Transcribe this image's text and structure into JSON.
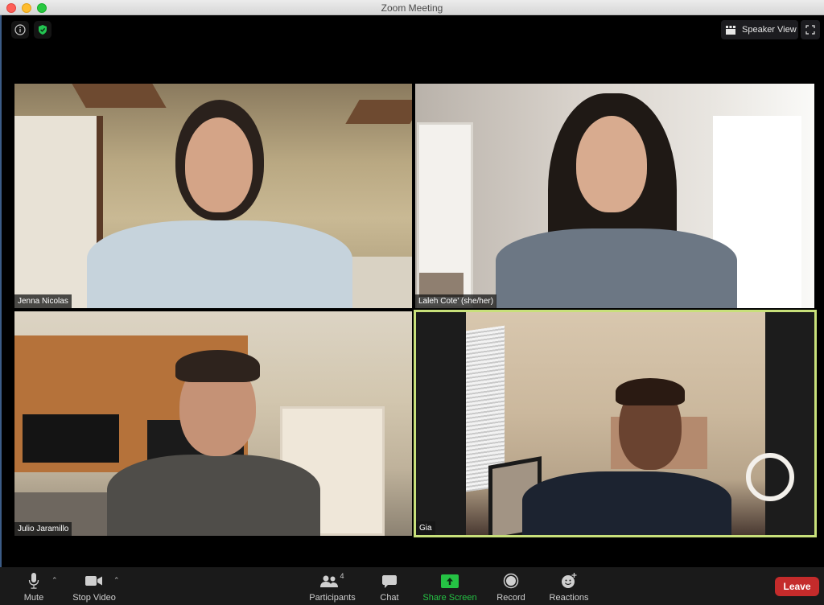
{
  "window": {
    "title": "Zoom Meeting"
  },
  "top_bar": {
    "info_icon": "info-icon",
    "security_icon": "shield-check-icon",
    "security_color": "#23c552",
    "view_button_label": "Speaker View",
    "view_button_icon": "grid-icon",
    "fullscreen_icon": "fullscreen-icon"
  },
  "participants": [
    {
      "name": "Jenna Nicolas",
      "active_speaker": false
    },
    {
      "name": "Laleh Cote' (she/her)",
      "active_speaker": false
    },
    {
      "name": "Julio Jaramillo",
      "active_speaker": false
    },
    {
      "name": "Gia",
      "active_speaker": true
    }
  ],
  "active_speaker_border_color": "#c8e07a",
  "toolbar": {
    "mute": {
      "label": "Mute",
      "icon": "microphone-icon"
    },
    "stop_video": {
      "label": "Stop Video",
      "icon": "video-camera-icon"
    },
    "participants": {
      "label": "Participants",
      "icon": "people-icon",
      "count": "4"
    },
    "chat": {
      "label": "Chat",
      "icon": "chat-bubble-icon"
    },
    "share_screen": {
      "label": "Share Screen",
      "icon": "share-up-arrow-icon",
      "color": "#25c244"
    },
    "record": {
      "label": "Record",
      "icon": "record-icon"
    },
    "reactions": {
      "label": "Reactions",
      "icon": "smiley-plus-icon"
    },
    "leave": {
      "label": "Leave",
      "color": "#c42b2b"
    }
  }
}
